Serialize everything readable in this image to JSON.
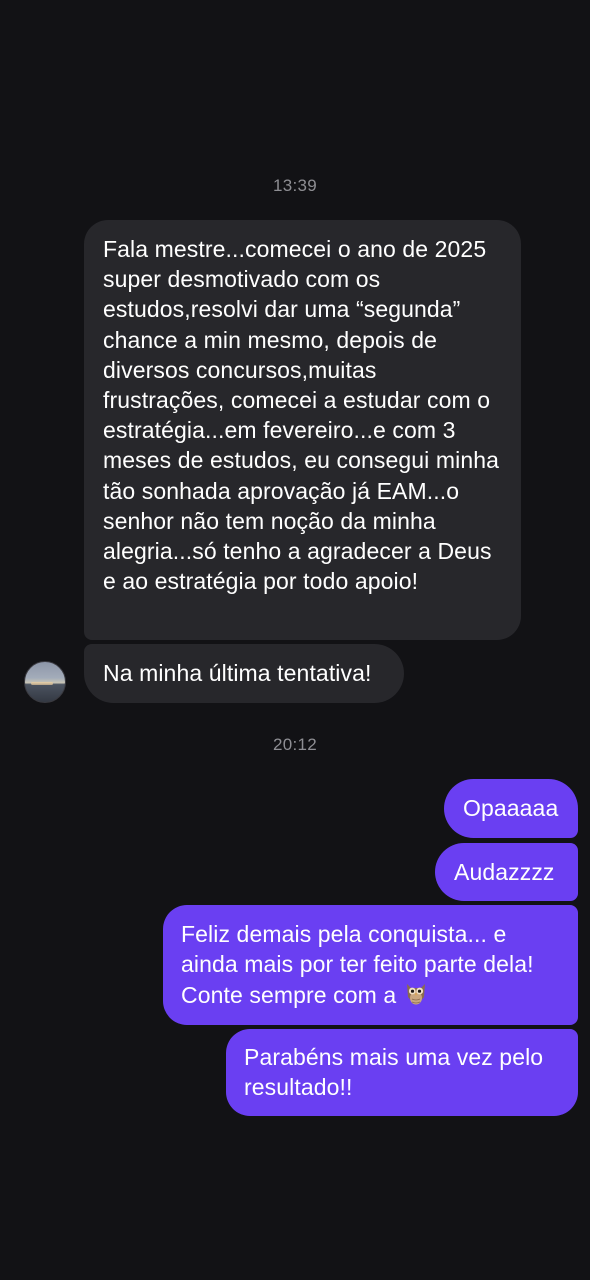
{
  "conversation": {
    "timestamp_1": "13:39",
    "incoming_message_1": "Fala mestre...comecei o ano de 2025 super desmotivado com os estudos,resolvi dar uma “segunda” chance a min mesmo, depois de diversos concursos,muitas frustrações, comecei a estudar com o estratégia...em fevereiro...e com 3 meses de estudos, eu consegui minha tão sonhada aprovação já EAM...o senhor não tem noção da minha alegria...só tenho a agradecer a Deus e ao estratégia por todo apoio!",
    "incoming_message_2": "Na minha última tentativa!",
    "timestamp_2": "20:12",
    "outgoing_message_1": "Opaaaaa",
    "outgoing_message_2": "Audazzzz",
    "outgoing_message_3": "Feliz demais pela conquista... e ainda mais por ter feito parte dela! Conte sempre com a",
    "outgoing_message_3_icon": "owl-emoji",
    "outgoing_message_4": "Parabéns mais uma vez pelo resultado!!"
  },
  "colors": {
    "background": "#121215",
    "incoming_bubble": "#27272b",
    "outgoing_bubble": "#6a3ff2",
    "timestamp_text": "#8e8e93",
    "message_text": "#ffffff"
  }
}
